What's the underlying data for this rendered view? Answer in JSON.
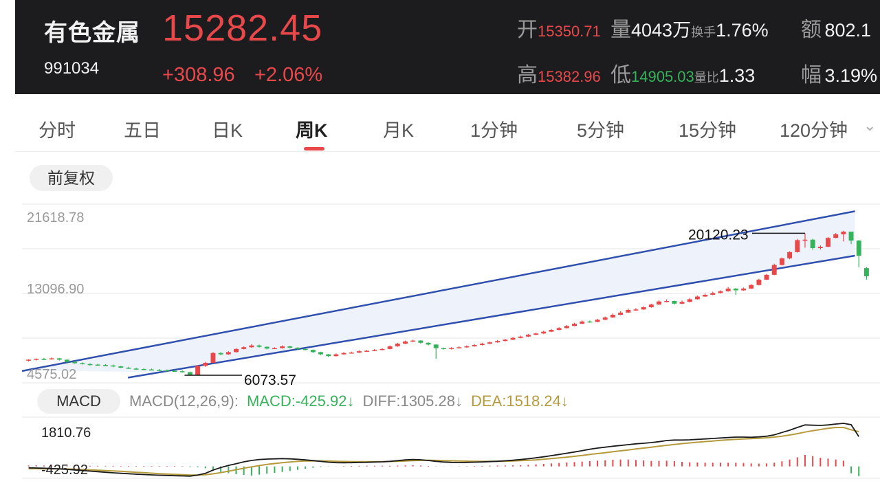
{
  "header": {
    "name": "有色金属",
    "code": "991034",
    "price": "15282.45",
    "change": "+308.96",
    "change_pct": "+2.06%",
    "open_label": "开",
    "open_value": "15350.71",
    "volume_label": "量",
    "volume_value": "4043万",
    "turnover_label": "换手",
    "turnover_value": "1.76%",
    "amount_label": "额",
    "amount_value": "802.1",
    "high_label": "高",
    "high_value": "15382.96",
    "low_label": "低",
    "low_value": "14905.03",
    "vol_ratio_label": "量比",
    "vol_ratio_value": "1.33",
    "amplitude_label": "幅",
    "amplitude_value": "3.19%"
  },
  "tabs": [
    "分时",
    "五日",
    "日K",
    "周K",
    "月K",
    "1分钟",
    "5分钟",
    "15分钟",
    "120分钟"
  ],
  "active_tab": "周K",
  "adjust_label": "前复权",
  "colors": {
    "up": "#e8484a",
    "down": "#36b35a",
    "channel": "#2e4fae",
    "dea": "#b59a3c"
  },
  "chart_data": {
    "type": "candlestick",
    "y_ticks": [
      "21618.78",
      "13096.90",
      "4575.02"
    ],
    "annotations": [
      {
        "text": "20120.23",
        "kind": "max",
        "candle_index": 101
      },
      {
        "text": "6073.57",
        "kind": "min",
        "candle_index": 21
      }
    ],
    "channel": {
      "upper": [
        [
          0,
          4700
        ],
        [
          108,
          22600
        ]
      ],
      "lower": [
        [
          17,
          4500
        ],
        [
          108,
          17600
        ]
      ]
    },
    "candles": [
      [
        5800,
        5900,
        5950,
        5700
      ],
      [
        5900,
        6000,
        6050,
        5800
      ],
      [
        6000,
        5950,
        6100,
        5850
      ],
      [
        5950,
        6050,
        6150,
        5900
      ],
      [
        6050,
        5900,
        6100,
        5800
      ],
      [
        5900,
        5650,
        5950,
        5550
      ],
      [
        5650,
        5500,
        5750,
        5450
      ],
      [
        5500,
        5400,
        5600,
        5350
      ],
      [
        5400,
        5350,
        5500,
        5250
      ],
      [
        5350,
        5300,
        5450,
        5200
      ],
      [
        5300,
        5250,
        5400,
        5150
      ],
      [
        5250,
        5150,
        5350,
        5050
      ],
      [
        5150,
        5000,
        5200,
        4950
      ],
      [
        5000,
        4900,
        5100,
        4850
      ],
      [
        4900,
        4850,
        5000,
        4800
      ],
      [
        4850,
        4800,
        4950,
        4750
      ],
      [
        4800,
        4750,
        4900,
        4700
      ],
      [
        4750,
        4700,
        4850,
        4650
      ],
      [
        4700,
        4650,
        4800,
        4600
      ],
      [
        4650,
        4600,
        4750,
        4550
      ],
      [
        4600,
        4500,
        4700,
        4450
      ],
      [
        4500,
        4200,
        4550,
        4150
      ],
      [
        4200,
        5200,
        5300,
        4150
      ],
      [
        5200,
        5550,
        5650,
        5100
      ],
      [
        5550,
        6650,
        6750,
        5500
      ],
      [
        6650,
        6500,
        6750,
        6400
      ],
      [
        6500,
        6750,
        6850,
        6450
      ],
      [
        6750,
        7100,
        7200,
        6700
      ],
      [
        7100,
        7300,
        7400,
        7050
      ],
      [
        7300,
        7500,
        7650,
        7250
      ],
      [
        7500,
        7350,
        7600,
        7250
      ],
      [
        7350,
        7150,
        7400,
        7050
      ],
      [
        7150,
        7200,
        7300,
        7100
      ],
      [
        7200,
        7400,
        7500,
        7150
      ],
      [
        7400,
        7250,
        7450,
        7150
      ],
      [
        7250,
        7100,
        7300,
        7000
      ],
      [
        7100,
        7000,
        7200,
        6950
      ],
      [
        7000,
        6750,
        7050,
        6650
      ],
      [
        6750,
        6500,
        6800,
        6400
      ],
      [
        6500,
        6300,
        6550,
        6200
      ],
      [
        6300,
        6500,
        6600,
        6250
      ],
      [
        6500,
        6650,
        6750,
        6450
      ],
      [
        6650,
        6700,
        6800,
        6600
      ],
      [
        6700,
        6850,
        6950,
        6650
      ],
      [
        6850,
        6900,
        7000,
        6800
      ],
      [
        6900,
        7000,
        7100,
        6850
      ],
      [
        7000,
        7100,
        7200,
        6950
      ],
      [
        7100,
        7400,
        7500,
        7050
      ],
      [
        7400,
        7700,
        7800,
        7350
      ],
      [
        7700,
        7950,
        8050,
        7650
      ],
      [
        7950,
        8050,
        8150,
        7900
      ],
      [
        8050,
        7800,
        8100,
        7700
      ],
      [
        7800,
        7600,
        7850,
        7500
      ],
      [
        7600,
        7200,
        7650,
        6000
      ],
      [
        7200,
        7100,
        7250,
        7050
      ],
      [
        7100,
        7200,
        7300,
        7050
      ],
      [
        7200,
        7300,
        7400,
        7150
      ],
      [
        7300,
        7400,
        7500,
        7250
      ],
      [
        7400,
        7550,
        7650,
        7350
      ],
      [
        7550,
        7700,
        7800,
        7500
      ],
      [
        7700,
        7850,
        7950,
        7650
      ],
      [
        7850,
        8000,
        8100,
        7800
      ],
      [
        8000,
        8150,
        8250,
        7950
      ],
      [
        8150,
        8350,
        8450,
        8100
      ],
      [
        8350,
        8500,
        8600,
        8300
      ],
      [
        8500,
        8700,
        8800,
        8450
      ],
      [
        8700,
        8850,
        8950,
        8650
      ],
      [
        8850,
        9050,
        9150,
        8800
      ],
      [
        9050,
        9250,
        9350,
        9000
      ],
      [
        9250,
        9450,
        9550,
        9200
      ],
      [
        9450,
        9700,
        9800,
        9400
      ],
      [
        9700,
        9950,
        10050,
        9650
      ],
      [
        9950,
        10200,
        10300,
        9900
      ],
      [
        10200,
        10150,
        10300,
        10050
      ],
      [
        10150,
        10400,
        10500,
        10100
      ],
      [
        10400,
        10650,
        10750,
        10350
      ],
      [
        10650,
        10950,
        11100,
        10600
      ],
      [
        10950,
        11200,
        11350,
        10900
      ],
      [
        11200,
        11500,
        11650,
        11150
      ],
      [
        11500,
        11550,
        11700,
        11400
      ],
      [
        11550,
        11800,
        11900,
        11500
      ],
      [
        11800,
        12100,
        12200,
        11750
      ],
      [
        12100,
        12450,
        12600,
        12050
      ],
      [
        12450,
        12500,
        12700,
        12350
      ],
      [
        12500,
        12200,
        12550,
        12100
      ],
      [
        12200,
        12400,
        12550,
        12150
      ],
      [
        12400,
        12700,
        12850,
        12350
      ],
      [
        12700,
        13000,
        13100,
        12650
      ],
      [
        13000,
        13200,
        13350,
        12950
      ],
      [
        13200,
        13400,
        13550,
        13150
      ],
      [
        13400,
        13600,
        13700,
        13350
      ],
      [
        13600,
        13900,
        14050,
        13550
      ],
      [
        13900,
        13700,
        13950,
        13200
      ],
      [
        13700,
        13900,
        14000,
        13650
      ],
      [
        13900,
        14300,
        14400,
        13850
      ],
      [
        14300,
        14900,
        15000,
        14250
      ],
      [
        14900,
        15450,
        15550,
        14850
      ],
      [
        15450,
        16550,
        16700,
        15400
      ],
      [
        16550,
        17300,
        17400,
        16500
      ],
      [
        17300,
        18000,
        18100,
        17200
      ],
      [
        18000,
        19350,
        19500,
        17950
      ],
      [
        19350,
        19400,
        20120,
        18500
      ],
      [
        19400,
        18450,
        19500,
        18250
      ],
      [
        18450,
        18600,
        18750,
        18300
      ],
      [
        18600,
        19600,
        19700,
        18550
      ],
      [
        19600,
        20000,
        20150,
        19550
      ],
      [
        20000,
        20300,
        20400,
        19200
      ],
      [
        20300,
        19300,
        19500,
        18900
      ],
      [
        19300,
        17600,
        19350,
        16300
      ],
      [
        16200,
        15283,
        16300,
        14905
      ]
    ]
  },
  "macd": {
    "label": "MACD",
    "params": "MACD(12,26,9):",
    "macd_value": "MACD:-425.92↓",
    "diff_value": "DIFF:1305.28↓",
    "dea_value": "DEA:1518.24↓",
    "top_tick": "1810.76",
    "bottom_tick": "-425.92",
    "diff": [
      -60,
      -70,
      -80,
      -95,
      -110,
      -130,
      -155,
      -180,
      -205,
      -230,
      -255,
      -280,
      -300,
      -320,
      -340,
      -355,
      -370,
      -385,
      -395,
      -405,
      -415,
      -425,
      -380,
      -300,
      -160,
      -50,
      40,
      120,
      200,
      260,
      300,
      320,
      330,
      340,
      330,
      310,
      285,
      255,
      220,
      185,
      165,
      160,
      165,
      175,
      180,
      190,
      200,
      220,
      250,
      285,
      300,
      290,
      260,
      220,
      190,
      175,
      170,
      175,
      185,
      195,
      210,
      225,
      245,
      270,
      300,
      335,
      375,
      420,
      470,
      520,
      575,
      630,
      690,
      750,
      800,
      840,
      880,
      915,
      950,
      985,
      1010,
      1040,
      1080,
      1130,
      1150,
      1150,
      1160,
      1180,
      1200,
      1220,
      1240,
      1260,
      1280,
      1280,
      1270,
      1290,
      1320,
      1380,
      1480,
      1580,
      1700,
      1810,
      1800,
      1790,
      1810,
      1850,
      1880,
      1820,
      1305
    ],
    "dea": [
      -100,
      -100,
      -102,
      -105,
      -110,
      -115,
      -125,
      -135,
      -150,
      -165,
      -180,
      -195,
      -215,
      -235,
      -255,
      -275,
      -295,
      -315,
      -330,
      -345,
      -360,
      -375,
      -378,
      -365,
      -325,
      -270,
      -210,
      -145,
      -80,
      -20,
      35,
      85,
      125,
      165,
      195,
      220,
      235,
      240,
      240,
      235,
      225,
      215,
      210,
      205,
      205,
      205,
      210,
      215,
      225,
      240,
      250,
      260,
      265,
      262,
      255,
      245,
      235,
      230,
      225,
      220,
      220,
      220,
      225,
      235,
      250,
      265,
      285,
      310,
      340,
      370,
      405,
      440,
      480,
      520,
      560,
      600,
      640,
      680,
      720,
      760,
      800,
      840,
      880,
      920,
      960,
      995,
      1025,
      1055,
      1085,
      1110,
      1135,
      1160,
      1180,
      1200,
      1215,
      1230,
      1250,
      1280,
      1320,
      1370,
      1430,
      1500,
      1560,
      1610,
      1660,
      1700,
      1700,
      1600,
      1518
    ],
    "hist": [
      40,
      45,
      40,
      30,
      25,
      20,
      20,
      20,
      25,
      25,
      25,
      25,
      20,
      20,
      20,
      20,
      20,
      20,
      20,
      20,
      20,
      -30,
      -40,
      -80,
      -170,
      -240,
      -300,
      -340,
      -370,
      -400,
      -360,
      -320,
      -280,
      -240,
      -200,
      -150,
      -100,
      -60,
      -30,
      -10,
      5,
      15,
      20,
      25,
      30,
      30,
      30,
      30,
      35,
      45,
      50,
      40,
      20,
      10,
      5,
      5,
      10,
      15,
      20,
      25,
      30,
      35,
      40,
      45,
      55,
      70,
      90,
      110,
      130,
      150,
      170,
      190,
      210,
      230,
      250,
      270,
      290,
      300,
      300,
      280,
      260,
      240,
      240,
      250,
      230,
      200,
      180,
      170,
      160,
      160,
      160,
      160,
      160,
      150,
      130,
      120,
      130,
      160,
      220,
      300,
      400,
      500,
      450,
      380,
      340,
      300,
      250,
      -300,
      -425.92
    ]
  }
}
